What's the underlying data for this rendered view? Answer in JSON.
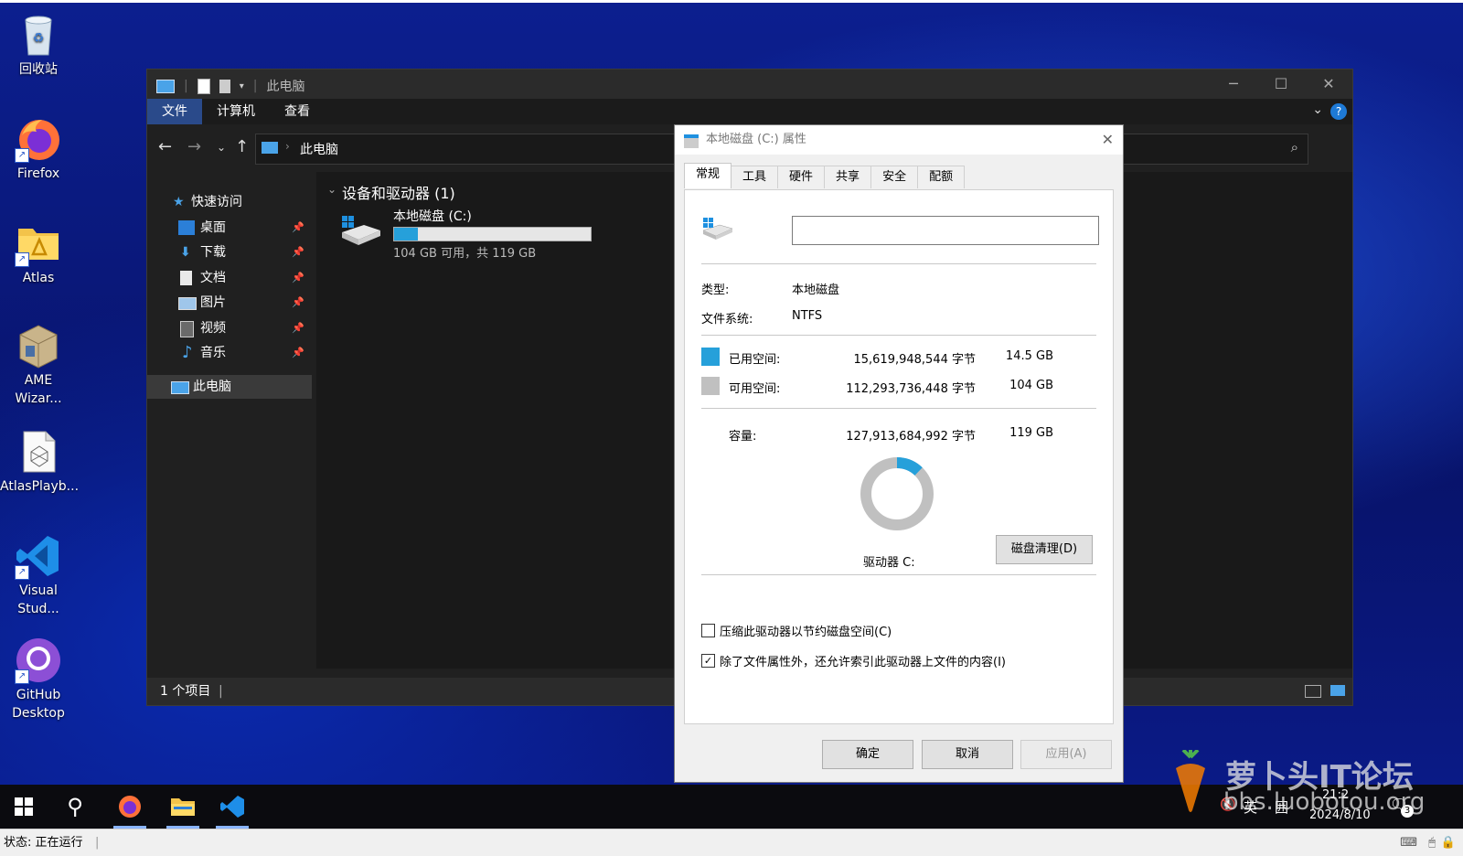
{
  "desktop": {
    "icons": [
      {
        "label": "回收站"
      },
      {
        "label": "Firefox"
      },
      {
        "label": "Atlas"
      },
      {
        "label": "AME Wizar..."
      },
      {
        "label": "AtlasPlayb..."
      },
      {
        "label": "Visual Stud..."
      },
      {
        "label": "GitHub Desktop"
      }
    ]
  },
  "explorer": {
    "title": "此电脑",
    "ribbon_tabs": [
      "文件",
      "计算机",
      "查看"
    ],
    "address": "此电脑",
    "nav": {
      "quick_access": "快速访问",
      "items": [
        "桌面",
        "下载",
        "文档",
        "图片",
        "视频",
        "音乐"
      ],
      "this_pc": "此电脑"
    },
    "group_header": "设备和驱动器 (1)",
    "drive": {
      "name": "本地磁盘 (C:)",
      "space_text": "104 GB 可用，共 119 GB",
      "used_fraction": 0.122
    },
    "status": "1 个项目"
  },
  "dialog": {
    "title": "本地磁盘 (C:) 属性",
    "tabs": [
      "常规",
      "工具",
      "硬件",
      "共享",
      "安全",
      "配额"
    ],
    "name_value": "",
    "type_label": "类型:",
    "type_value": "本地磁盘",
    "fs_label": "文件系统:",
    "fs_value": "NTFS",
    "used_label": "已用空间:",
    "used_bytes": "15,619,948,544 字节",
    "used_gb": "14.5 GB",
    "free_label": "可用空间:",
    "free_bytes": "112,293,736,448 字节",
    "free_gb": "104 GB",
    "cap_label": "容量:",
    "cap_bytes": "127,913,684,992 字节",
    "cap_gb": "119 GB",
    "used_fraction": 0.122,
    "drive_label": "驱动器 C:",
    "cleanup_button": "磁盘清理(D)",
    "compress_label": "压缩此驱动器以节约磁盘空间(C)",
    "compress_checked": false,
    "index_label": "除了文件属性外，还允许索引此驱动器上文件的内容(I)",
    "index_checked": true,
    "ok_button": "确定",
    "cancel_button": "取消",
    "apply_button": "应用(A)",
    "colors": {
      "used": "#26a0da",
      "free": "#c0c0c0"
    }
  },
  "taskbar": {
    "tray": {
      "volume_icon": "volume-muted-icon",
      "ime": "英",
      "ime2": "囲",
      "time": "21:2",
      "date": "2024/8/10",
      "notifications": "3"
    }
  },
  "vm_status": {
    "label": "状态: 正在运行"
  },
  "watermark": {
    "title": "萝卜头IT论坛",
    "url": "bbs.luobotou.org"
  }
}
